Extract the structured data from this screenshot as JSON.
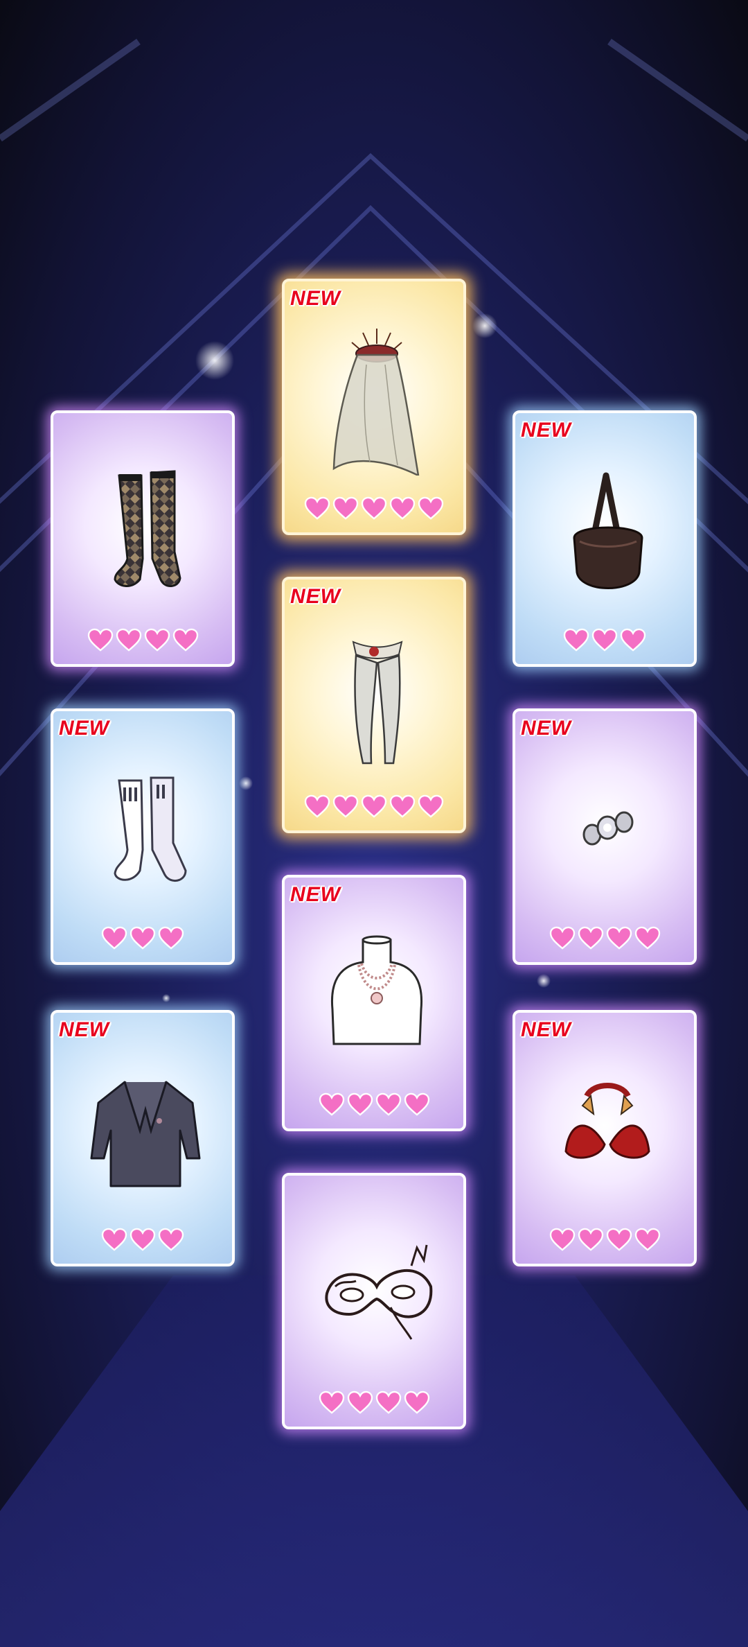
{
  "screen": "item-reveal",
  "badge_label": "NEW",
  "colors": {
    "heart": "#f46fc4",
    "badge": "#e8001d",
    "purple_glow": "#d68cff",
    "blue_glow": "#a0d2ff",
    "gold_glow": "#ffbe5a"
  },
  "cards": [
    {
      "item": "sheer-veil-crown",
      "rarity": "gold",
      "is_new": true,
      "hearts": 5
    },
    {
      "item": "argyle-socks",
      "rarity": "purple",
      "is_new": false,
      "hearts": 4
    },
    {
      "item": "leather-shoulder-bag",
      "rarity": "blue",
      "is_new": true,
      "hearts": 3
    },
    {
      "item": "garter-stockings",
      "rarity": "gold",
      "is_new": true,
      "hearts": 5
    },
    {
      "item": "white-ankle-socks",
      "rarity": "blue",
      "is_new": true,
      "hearts": 3
    },
    {
      "item": "jeweled-bracelet",
      "rarity": "purple",
      "is_new": true,
      "hearts": 4
    },
    {
      "item": "layered-necklace",
      "rarity": "purple",
      "is_new": true,
      "hearts": 4
    },
    {
      "item": "navy-blazer",
      "rarity": "blue",
      "is_new": true,
      "hearts": 3
    },
    {
      "item": "red-bikini-top",
      "rarity": "purple",
      "is_new": true,
      "hearts": 4
    },
    {
      "item": "lace-masquerade-mask",
      "rarity": "purple",
      "is_new": false,
      "hearts": 4
    }
  ]
}
